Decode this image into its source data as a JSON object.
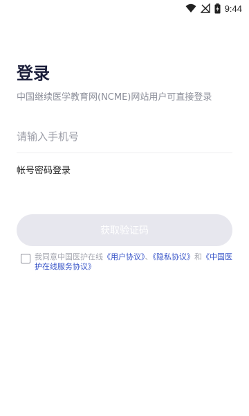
{
  "status_bar": {
    "time": "9:44",
    "icons": [
      "wifi-icon",
      "no-signal-icon",
      "battery-charging-icon"
    ]
  },
  "page": {
    "title": "登录",
    "subtitle": "中国继续医学教育网(NCME)网站用户可直接登录"
  },
  "form": {
    "phone_placeholder": "请输入手机号",
    "phone_value": "",
    "account_login_label": "帐号密码登录",
    "get_code_label": "获取验证码"
  },
  "agreement": {
    "checked": false,
    "prefix": "我同意中国医护在线",
    "user_agreement": "《用户协议》",
    "sep1": "、",
    "privacy_policy": "《隐私协议》",
    "and": "和",
    "service_agreement": "《中国医护在线服务协议》"
  },
  "colors": {
    "title": "#1c1f3b",
    "link": "#3b57c9",
    "button_disabled_bg": "#e7e7ee"
  }
}
